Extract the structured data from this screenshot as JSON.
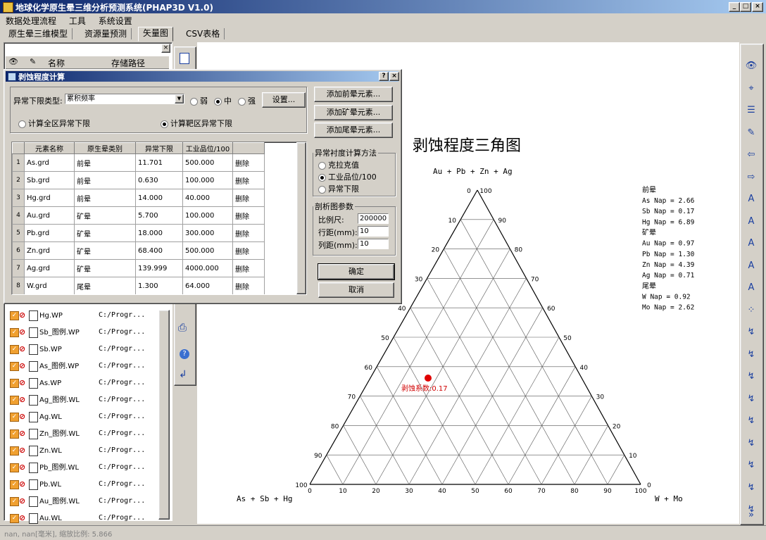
{
  "window": {
    "title": "地球化学原生晕三维分析预测系统(PHAP3D V1.0)"
  },
  "menu": [
    "数据处理流程",
    "工具",
    "系统设置"
  ],
  "tabs": [
    "原生晕三维模型",
    "资源量预测",
    "矢量图",
    "CSV表格"
  ],
  "left_panel": {
    "headers": [
      "名称",
      "存储路径"
    ],
    "rows": [
      {
        "name": "Hg.WP",
        "path": "C:/Progr..."
      },
      {
        "name": "Sb_图例.WP",
        "path": "C:/Progr..."
      },
      {
        "name": "Sb.WP",
        "path": "C:/Progr..."
      },
      {
        "name": "As_图例.WP",
        "path": "C:/Progr..."
      },
      {
        "name": "As.WP",
        "path": "C:/Progr..."
      },
      {
        "name": "Ag_图例.WL",
        "path": "C:/Progr..."
      },
      {
        "name": "Ag.WL",
        "path": "C:/Progr..."
      },
      {
        "name": "Zn_图例.WL",
        "path": "C:/Progr..."
      },
      {
        "name": "Zn.WL",
        "path": "C:/Progr..."
      },
      {
        "name": "Pb_图例.WL",
        "path": "C:/Progr..."
      },
      {
        "name": "Pb.WL",
        "path": "C:/Progr..."
      },
      {
        "name": "Au_图例.WL",
        "path": "C:/Progr..."
      },
      {
        "name": "Au.WL",
        "path": "C:/Progr..."
      }
    ]
  },
  "dialog": {
    "title": "剥蚀程度计算",
    "lower_limit_label": "异常下限类型:",
    "lower_limit_value": "累积频率",
    "strength": [
      "弱",
      "中",
      "强"
    ],
    "settings_button": "设置...",
    "calc_options": [
      "计算全区异常下限",
      "计算靶区异常下限"
    ],
    "add_buttons": [
      "添加前晕元素...",
      "添加矿晕元素...",
      "添加尾晕元素..."
    ],
    "table_headers": [
      "元素名称",
      "原生晕类别",
      "异常下限",
      "工业品位/100",
      ""
    ],
    "table_rows": [
      [
        "1",
        "As.grd",
        "前晕",
        "11.701",
        "500.000",
        "删除"
      ],
      [
        "2",
        "Sb.grd",
        "前晕",
        "0.630",
        "100.000",
        "删除"
      ],
      [
        "3",
        "Hg.grd",
        "前晕",
        "14.000",
        "40.000",
        "删除"
      ],
      [
        "4",
        "Au.grd",
        "矿晕",
        "5.700",
        "100.000",
        "删除"
      ],
      [
        "5",
        "Pb.grd",
        "矿晕",
        "18.000",
        "300.000",
        "删除"
      ],
      [
        "6",
        "Zn.grd",
        "矿晕",
        "68.400",
        "500.000",
        "删除"
      ],
      [
        "7",
        "Ag.grd",
        "矿晕",
        "139.999",
        "4000.000",
        "删除"
      ],
      [
        "8",
        "W.grd",
        "尾晕",
        "1.300",
        "64.000",
        "删除"
      ]
    ],
    "method_group": "异常衬度计算方法",
    "methods": [
      "克拉克值",
      "工业品位/100",
      "异常下限"
    ],
    "params_group": "剖析图参数",
    "params": [
      {
        "label": "比例尺:",
        "value": "200000"
      },
      {
        "label": "行距(mm):",
        "value": "10"
      },
      {
        "label": "列距(mm):",
        "value": "10"
      }
    ],
    "ok": "确定",
    "cancel": "取消"
  },
  "chart_data": {
    "type": "ternary",
    "title": "剥蚀程度三角图",
    "top_label": "Au + Pb + Zn + Ag",
    "left_label": "As + Sb + Hg",
    "right_label": "W + Mo",
    "ticks": [
      0,
      10,
      20,
      30,
      40,
      50,
      60,
      70,
      80,
      90,
      100
    ],
    "point": {
      "label": "剥蚀系数:0.17"
    },
    "legend": [
      {
        "group": "前晕",
        "items": [
          "As Nap = 2.66",
          "Sb Nap = 0.17",
          "Hg Nap = 6.89"
        ]
      },
      {
        "group": "矿晕",
        "items": [
          "Au Nap = 0.97",
          "Pb Nap = 1.30",
          "Zn Nap = 4.39",
          "Ag Nap = 0.71"
        ]
      },
      {
        "group": "尾晕",
        "items": [
          "W Nap = 0.92",
          "Mo Nap = 2.62"
        ]
      }
    ]
  },
  "status_bar": "nan, nan[毫米], 缩放比例: 5.866"
}
